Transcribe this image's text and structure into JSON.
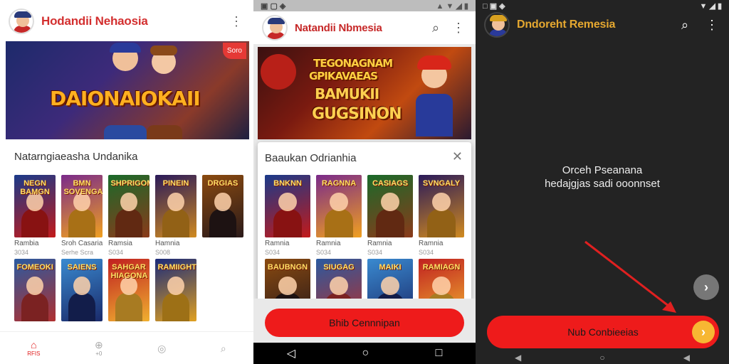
{
  "screen1": {
    "app_title": "Hodandii Nehaosia",
    "badge": "Soro",
    "banner_text": "DAIONAIOKAII",
    "banner_sub": "",
    "section_title": "Natarngiaeasha Undanika",
    "games": [
      {
        "label": "Rambia",
        "sub": "3034",
        "art": "NEGN BAMGN"
      },
      {
        "label": "Sroh Casaria",
        "sub": "Serhe Scra",
        "art": "BMN SOVENGA"
      },
      {
        "label": "Ramsia",
        "sub": "S034",
        "art": "SHPRIGOME"
      },
      {
        "label": "Hamnia",
        "sub": "S008",
        "art": "PINEIN"
      },
      {
        "label": "",
        "sub": "",
        "art": "DRGIAS"
      },
      {
        "label": "",
        "sub": "",
        "art": "FOMEOKI"
      },
      {
        "label": "",
        "sub": "",
        "art": "SAIENS"
      },
      {
        "label": "",
        "sub": "",
        "art": "SAHGAR HIAGONA"
      },
      {
        "label": "",
        "sub": "",
        "art": "RAMIIGHT"
      }
    ],
    "nav": [
      {
        "label": "RFIS",
        "icon": "home"
      },
      {
        "label": "+0",
        "icon": "add"
      },
      {
        "label": "",
        "icon": "person"
      },
      {
        "label": "",
        "icon": "search"
      }
    ]
  },
  "screen2": {
    "app_title": "Natandii Nbmesia",
    "banner_line1": "TEGONAGNAM",
    "banner_line2": "GPIKAVAEAS",
    "banner_line3": "BAMUKII",
    "banner_line4": "GUGSINON",
    "dialog_title": "Baaukan Odrianhia",
    "games": [
      {
        "label": "Ramnia",
        "sub": "S034",
        "art": "BNKNN"
      },
      {
        "label": "Ramnia",
        "sub": "S034",
        "art": "RAGNNA"
      },
      {
        "label": "Ramnia",
        "sub": "S034",
        "art": "CASIAGS"
      },
      {
        "label": "Ramnia",
        "sub": "S034",
        "art": "SVNGALY"
      },
      {
        "label": "",
        "sub": "",
        "art": "BAUBNGN"
      },
      {
        "label": "",
        "sub": "",
        "art": "SIUGAG"
      },
      {
        "label": "",
        "sub": "",
        "art": "MAIKI"
      },
      {
        "label": "",
        "sub": "",
        "art": "RAMIAGN"
      }
    ],
    "cta_label": "Bhib Cennnipan"
  },
  "screen3": {
    "app_title": "Dndoreht Remesia",
    "message_line1": "Orceh Pseanana",
    "message_line2": "hedajgjas sadi ooonnset",
    "cta_label": "Nub Conbieeias"
  },
  "colors": {
    "accent": "#ee1b1b",
    "dark_bg": "#232323",
    "title_red": "#d32f2f",
    "arrow_yellow": "#f7b733"
  }
}
